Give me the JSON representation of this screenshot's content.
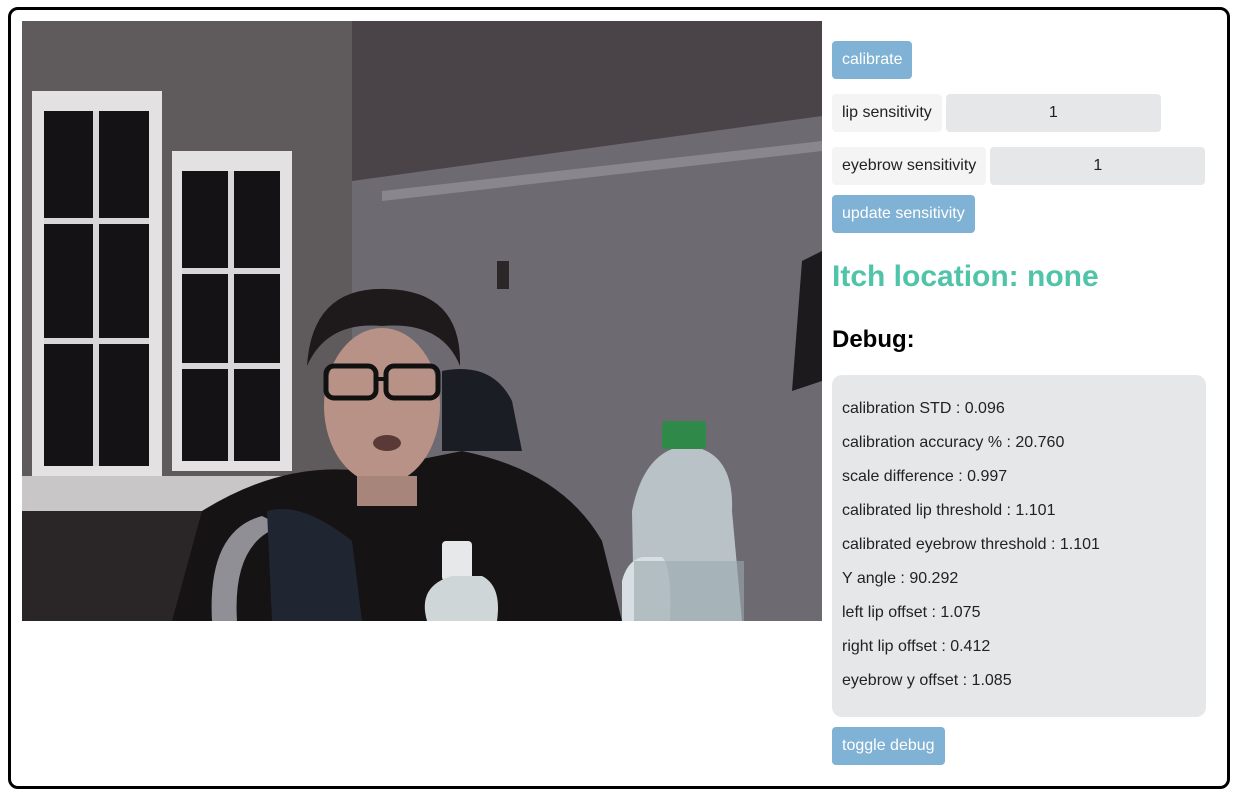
{
  "buttons": {
    "calibrate": "calibrate",
    "update_sensitivity": "update sensitivity",
    "toggle_debug": "toggle debug"
  },
  "sensitivity": {
    "lip_label": "lip sensitivity",
    "lip_value": "1",
    "eyebrow_label": "eyebrow sensitivity",
    "eyebrow_value": "1"
  },
  "itch_location": "Itch location: none",
  "debug": {
    "title": "Debug:",
    "lines": [
      "calibration STD : 0.096",
      "calibration accuracy % : 20.760",
      "scale difference : 0.997",
      "calibrated lip threshold : 1.101",
      "calibrated eyebrow threshold : 1.101",
      "Y angle : 90.292",
      "left lip offset : 1.075",
      "right lip offset : 0.412",
      "eyebrow y offset : 1.085"
    ]
  },
  "colors": {
    "button": "#7fb2d4",
    "itch": "#4fc4a8",
    "debug_bg": "#e6e7e8",
    "frame_border": "#000000"
  }
}
